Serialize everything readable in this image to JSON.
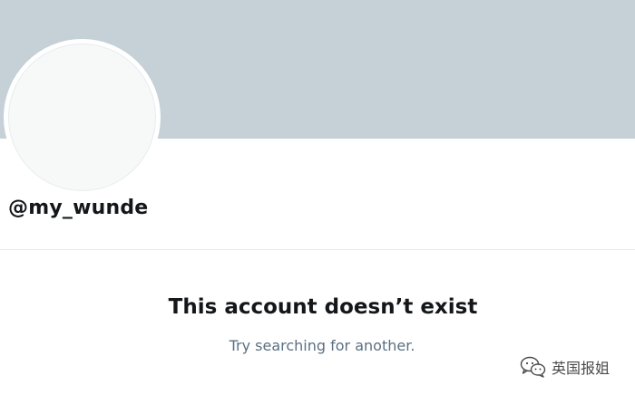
{
  "profile": {
    "handle": "@my_wunde"
  },
  "empty_state": {
    "title": "This account doesn’t exist",
    "subtitle": "Try searching for another."
  },
  "watermark": {
    "icon": "wechat-icon",
    "text": "英国报姐"
  },
  "colors": {
    "banner": "#c5d0d7",
    "avatar_fill": "#f7f9f9",
    "text_primary": "#14171a",
    "text_secondary": "#5b7083",
    "divider": "#e6ecf0"
  }
}
